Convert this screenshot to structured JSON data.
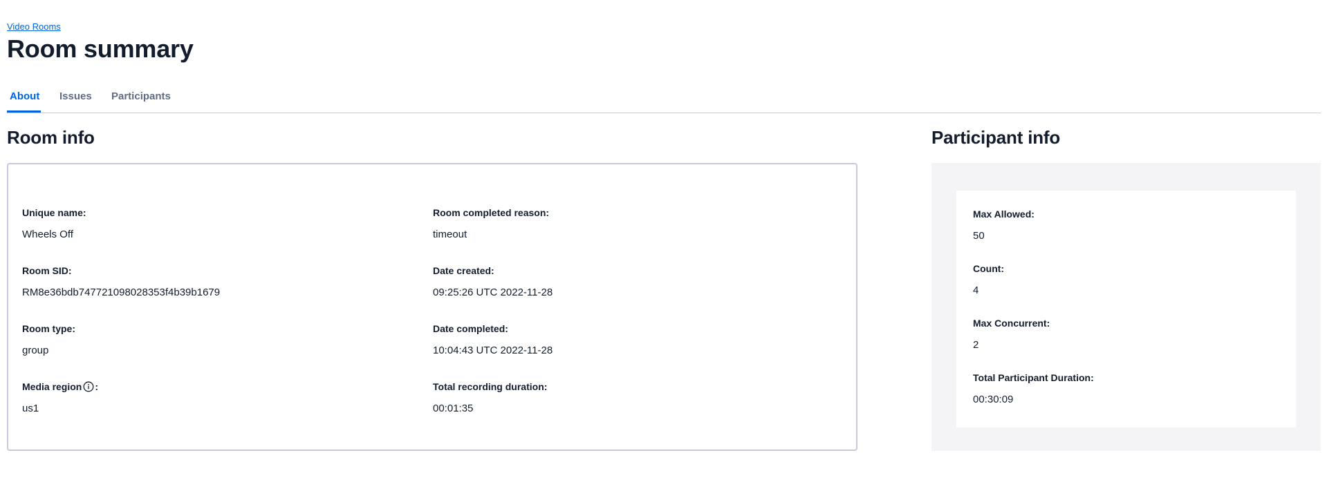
{
  "breadcrumb": {
    "label": "Video Rooms"
  },
  "page_title": "Room summary",
  "tabs": [
    {
      "label": "About",
      "active": true
    },
    {
      "label": "Issues",
      "active": false
    },
    {
      "label": "Participants",
      "active": false
    }
  ],
  "room_info": {
    "heading": "Room info",
    "fields": {
      "unique_name": {
        "label": "Unique name:",
        "value": "Wheels Off"
      },
      "room_sid": {
        "label": "Room SID:",
        "value": "RM8e36bdb747721098028353f4b39b1679"
      },
      "room_type": {
        "label": "Room type:",
        "value": "group"
      },
      "media_region": {
        "label": "Media region",
        "suffix": ":",
        "value": "us1",
        "icon": "info-icon"
      },
      "completed_reason": {
        "label": "Room completed reason:",
        "value": "timeout"
      },
      "date_created": {
        "label": "Date created:",
        "value": "09:25:26 UTC 2022-11-28"
      },
      "date_completed": {
        "label": "Date completed:",
        "value": "10:04:43 UTC 2022-11-28"
      },
      "recording_duration": {
        "label": "Total recording duration:",
        "value": "00:01:35"
      }
    }
  },
  "participant_info": {
    "heading": "Participant info",
    "fields": {
      "max_allowed": {
        "label": "Max Allowed:",
        "value": "50"
      },
      "count": {
        "label": "Count:",
        "value": "4"
      },
      "max_concurrent": {
        "label": "Max Concurrent:",
        "value": "2"
      },
      "total_duration": {
        "label": "Total Participant Duration:",
        "value": "00:30:09"
      }
    }
  },
  "colors": {
    "link": "#0263e0",
    "text": "#121c2d",
    "muted_tab": "#606b85",
    "box_border": "#c5c8df",
    "panel_bg": "#f4f4f6"
  }
}
